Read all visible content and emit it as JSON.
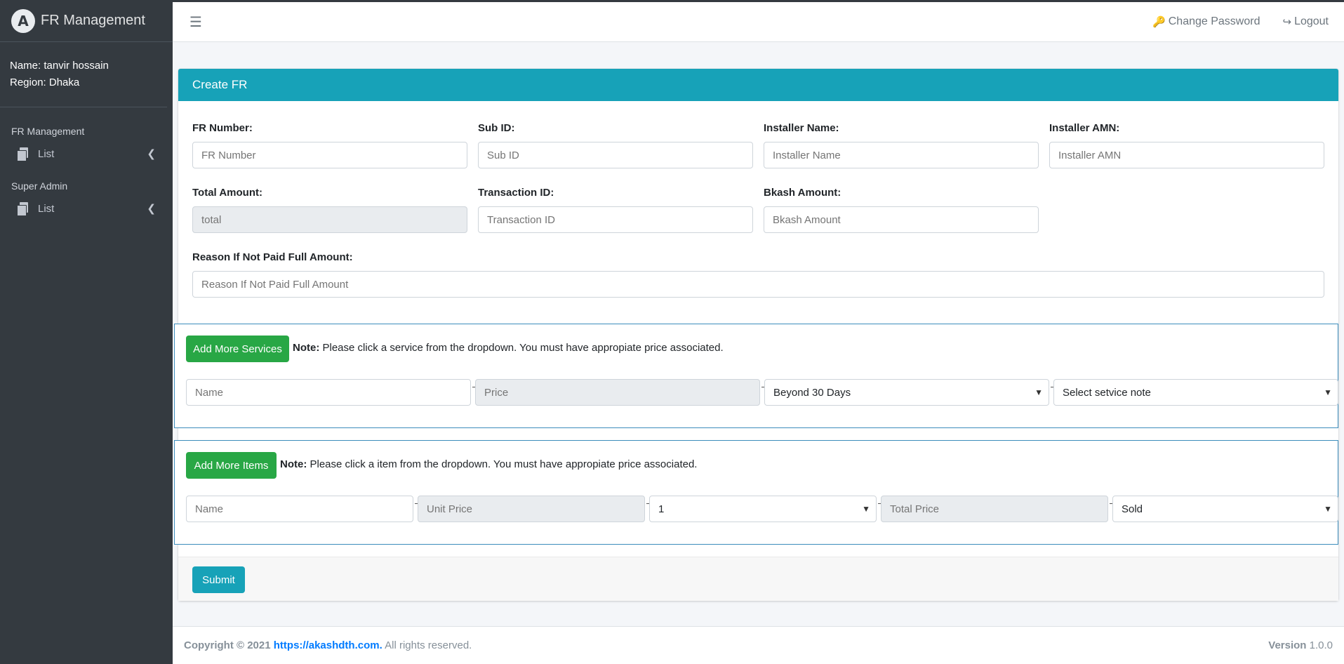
{
  "sidebar": {
    "brand": "FR Management",
    "brand_logo": "A",
    "user_name": "Name: tanvir hossain",
    "user_region": "Region: Dhaka",
    "sections": [
      {
        "header": "FR Management",
        "item": "List"
      },
      {
        "header": "Super Admin",
        "item": "List"
      }
    ]
  },
  "navbar": {
    "change_password": "Change Password",
    "logout": "Logout"
  },
  "card": {
    "title": "Create FR",
    "fields": {
      "fr_number": {
        "label": "FR Number:",
        "placeholder": "FR Number"
      },
      "sub_id": {
        "label": "Sub ID:",
        "placeholder": "Sub ID"
      },
      "installer_name": {
        "label": "Installer Name:",
        "placeholder": "Installer Name"
      },
      "installer_amn": {
        "label": "Installer AMN:",
        "placeholder": "Installer AMN"
      },
      "total_amount": {
        "label": "Total Amount:",
        "placeholder": "total"
      },
      "transaction_id": {
        "label": "Transaction ID:",
        "placeholder": "Transaction ID"
      },
      "bkash_amount": {
        "label": "Bkash Amount:",
        "placeholder": "Bkash Amount"
      },
      "reason": {
        "label": "Reason If Not Paid Full Amount:",
        "placeholder": "Reason If Not Paid Full Amount"
      }
    },
    "services": {
      "button": "Add More Services",
      "note_bold": "Note:",
      "note_text": " Please click a service from the dropdown. You must have appropiate price associated.",
      "name_placeholder": "Name",
      "price_placeholder": "Price",
      "duration_selected": "Beyond 30 Days",
      "note_selected": "Select setvice note"
    },
    "items": {
      "button": "Add More Items",
      "note_bold": "Note:",
      "note_text": " Please click a item from the dropdown. You must have appropiate price associated.",
      "name_placeholder": "Name",
      "unit_price_placeholder": "Unit Price",
      "quantity_selected": "1",
      "total_price_placeholder": "Total Price",
      "status_selected": "Sold"
    },
    "submit": "Submit"
  },
  "footer": {
    "copyright": "Copyright © 2021 ",
    "link": "https://akashdth.com.",
    "rights": " All rights reserved.",
    "version_label": "Version",
    "version": " 1.0.0"
  }
}
